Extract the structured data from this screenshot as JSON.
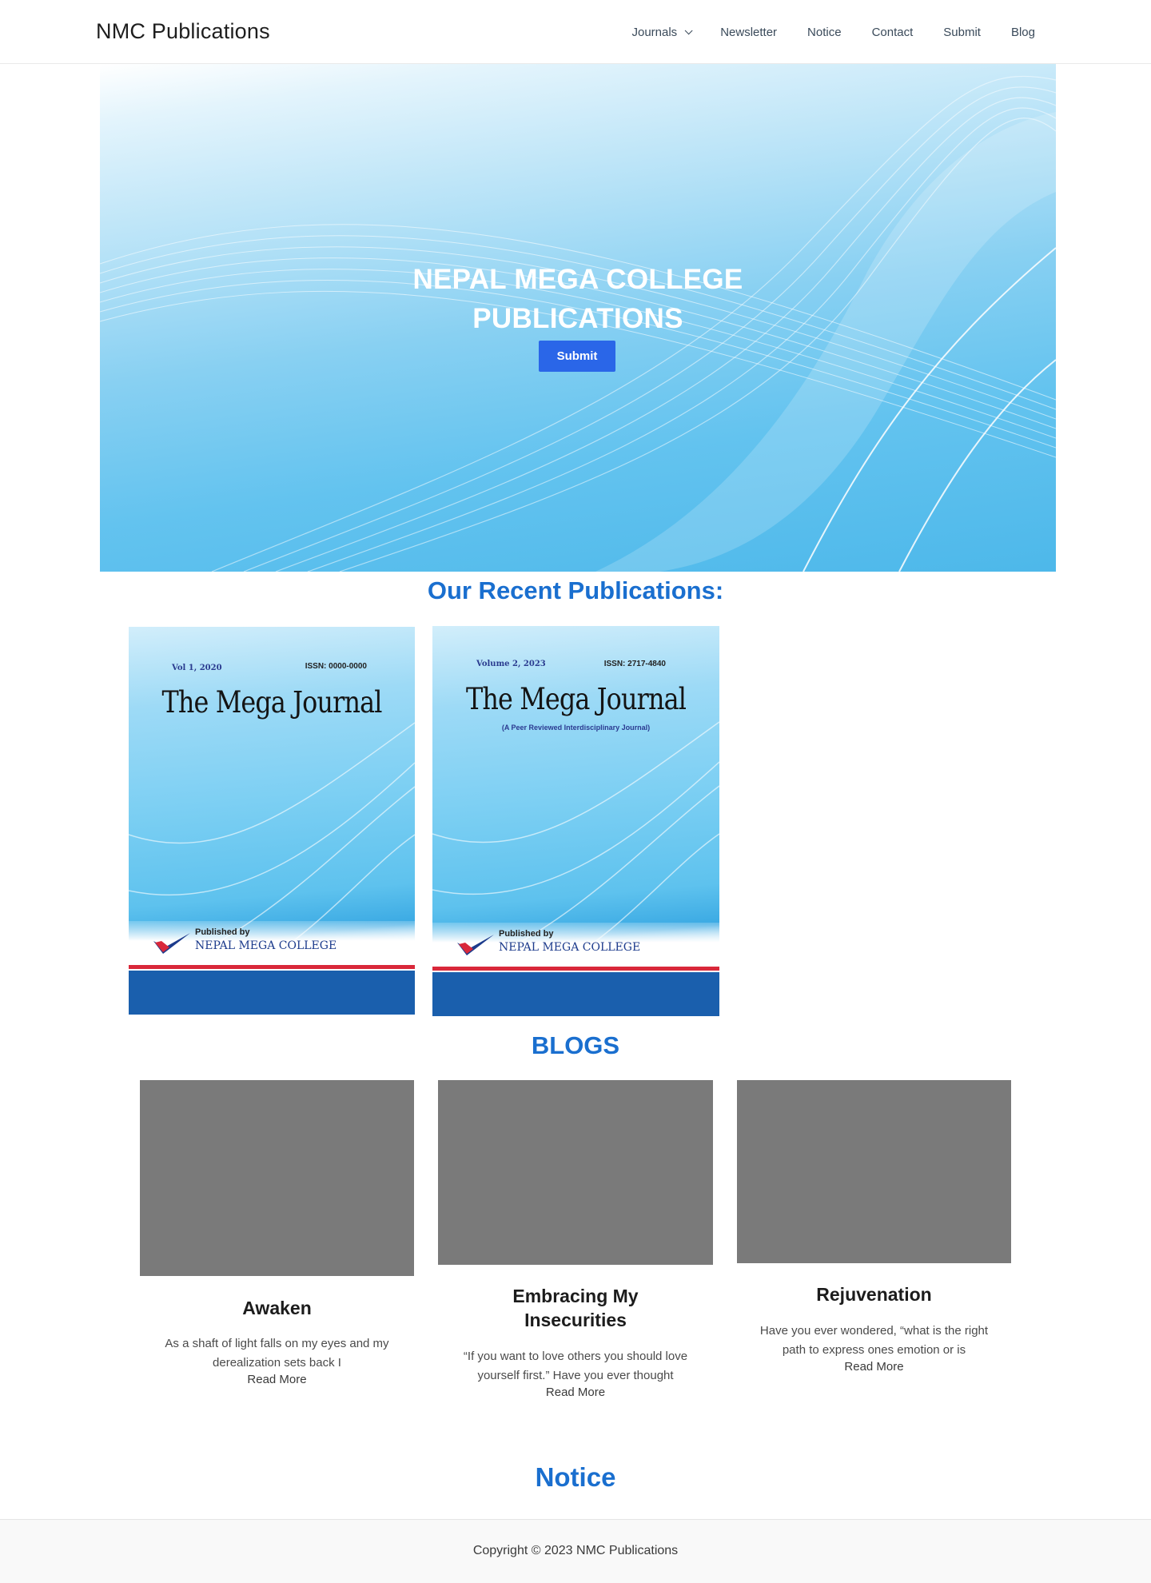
{
  "header": {
    "brand": "NMC Publications",
    "nav": [
      {
        "label": "Journals",
        "has_dropdown": true
      },
      {
        "label": "Newsletter"
      },
      {
        "label": "Notice"
      },
      {
        "label": "Contact"
      },
      {
        "label": "Submit"
      },
      {
        "label": "Blog"
      }
    ]
  },
  "hero": {
    "title_line1": "NEPAL MEGA COLLEGE",
    "title_line2": "PUBLICATIONS",
    "button_label": "Submit"
  },
  "publications": {
    "heading": "Our Recent Publications:",
    "items": [
      {
        "volume": "Vol 1, 2020",
        "issn": "ISSN: 0000-0000",
        "title": "The Mega Journal",
        "subtitle": "",
        "published_by": "Published by",
        "publisher": "NEPAL MEGA COLLEGE"
      },
      {
        "volume": "Volume 2, 2023",
        "issn": "ISSN: 2717-4840",
        "title": "The Mega Journal",
        "subtitle": "(A Peer Reviewed Interdisciplinary Journal)",
        "published_by": "Published by",
        "publisher": "NEPAL MEGA COLLEGE"
      }
    ]
  },
  "blogs": {
    "heading": "BLOGS",
    "items": [
      {
        "title": "Awaken",
        "excerpt_line1": "As a shaft of light falls on my eyes and my",
        "excerpt_line2": "derealization sets back I",
        "read_more": "Read More"
      },
      {
        "title_line1": "Embracing My",
        "title_line2": "Insecurities",
        "excerpt_line1": "“If you want to love others you should love",
        "excerpt_line2": "yourself first.” Have you ever thought",
        "read_more": "Read More"
      },
      {
        "title": "Rejuvenation",
        "excerpt_line1": "Have you ever wondered, “what is the right",
        "excerpt_line2": "path to express ones emotion or is",
        "read_more": "Read More"
      }
    ]
  },
  "notice": {
    "heading": "Notice"
  },
  "footer": {
    "copyright": "Copyright © 2023 NMC Publications"
  },
  "colors": {
    "accent_heading": "#1a6fcf",
    "button": "#2a66e8",
    "blog_placeholder": "#7a7a7a"
  },
  "icons": {
    "journals_dropdown": "chevron-down-icon",
    "publisher_logo": "nmc-checkmark-logo"
  }
}
